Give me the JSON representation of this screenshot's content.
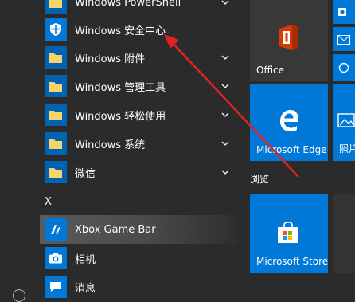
{
  "app_list": {
    "items": [
      {
        "label": "Windows PowerShell",
        "icon": "folder-icon",
        "expandable": true
      },
      {
        "label": "Windows 安全中心",
        "icon": "shield-icon",
        "expandable": false
      },
      {
        "label": "Windows 附件",
        "icon": "folder-icon",
        "expandable": true
      },
      {
        "label": "Windows 管理工具",
        "icon": "folder-icon",
        "expandable": true
      },
      {
        "label": "Windows 轻松使用",
        "icon": "folder-icon",
        "expandable": true
      },
      {
        "label": "Windows 系统",
        "icon": "folder-icon",
        "expandable": true
      },
      {
        "label": "微信",
        "icon": "folder-icon",
        "expandable": true
      }
    ],
    "section_x": "X",
    "items_x": [
      {
        "label": "Xbox Game Bar",
        "icon": "xbox-game-bar-icon"
      },
      {
        "label": "相机",
        "icon": "camera-icon"
      },
      {
        "label": "消息",
        "icon": "message-icon"
      }
    ]
  },
  "tiles": {
    "office": {
      "label": "Office",
      "icon": "office-icon"
    },
    "edge": {
      "label": "Microsoft Edge",
      "icon": "edge-icon"
    },
    "photos_partial": {
      "label": "照片",
      "icon": "photos-icon"
    },
    "group_browse": "浏览",
    "store": {
      "label": "Microsoft Store",
      "icon": "store-icon"
    }
  },
  "colors": {
    "background": "#2b2b2b",
    "accent_tile": "#0078d7",
    "folder_yellow": "#f6d36b",
    "arrow_red": "#e32222",
    "office_red": "#d83b01"
  }
}
